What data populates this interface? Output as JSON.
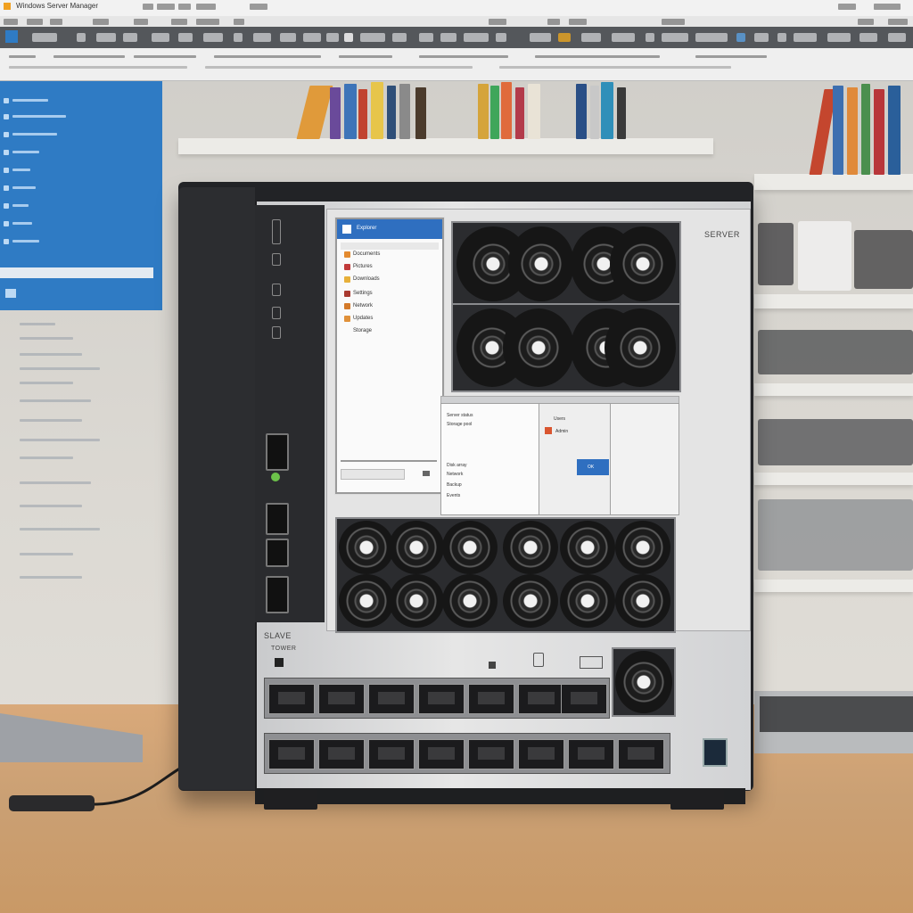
{
  "menubar": {
    "title": "Windows Server Manager"
  },
  "chassis": {
    "brand_top_right": "SERVER",
    "brand_bottom_left": "SLAVE",
    "brand_bottom_left_sub": "TOWER"
  },
  "screen": {
    "window1": {
      "title": "Explorer",
      "items": [
        "Documents",
        "Pictures",
        "Downloads",
        "Settings",
        "Network",
        "Updates",
        "Storage"
      ]
    },
    "window2": {
      "lines": [
        "Server status",
        "Storage pool",
        "Disk array",
        "Network",
        "Backup",
        "Events"
      ]
    },
    "window3": {
      "header": "Users",
      "user": "Admin",
      "button": "OK"
    }
  },
  "colors": {
    "accent": "#2f6fc0",
    "chassis": "#222326",
    "panel": "#d8d9db",
    "led_green": "#6cc24a"
  },
  "icons": [
    "app-icon",
    "folder-icon",
    "fan-icon",
    "power-icon",
    "usb-port-icon"
  ]
}
